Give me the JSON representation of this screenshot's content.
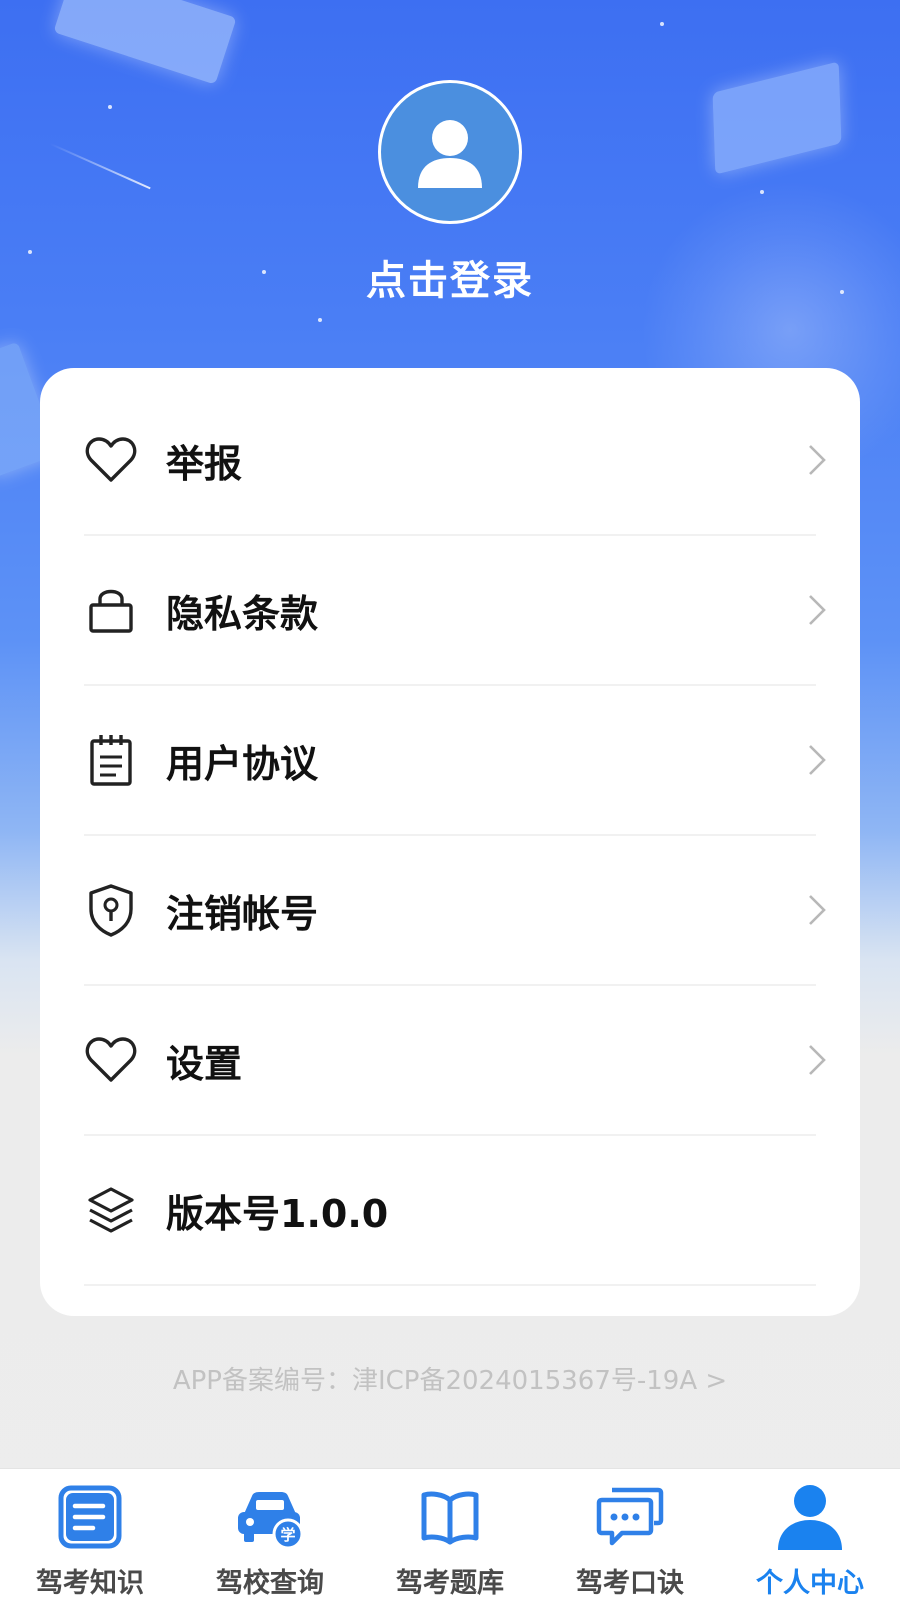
{
  "profile": {
    "login_prompt": "点击登录",
    "avatar_icon": "user-avatar-icon"
  },
  "menu": {
    "items": [
      {
        "label": "举报",
        "icon": "heart-icon",
        "has_chevron": true
      },
      {
        "label": "隐私条款",
        "icon": "lock-icon",
        "has_chevron": true
      },
      {
        "label": "用户协议",
        "icon": "notepad-icon",
        "has_chevron": true
      },
      {
        "label": "注销帐号",
        "icon": "shield-keyhole-icon",
        "has_chevron": true
      },
      {
        "label": "设置",
        "icon": "heart-icon",
        "has_chevron": true
      },
      {
        "label": "版本号1.0.0",
        "icon": "layers-icon",
        "has_chevron": false
      }
    ]
  },
  "footer": {
    "icp_record": "APP备案编号：津ICP备2024015367号-19A >"
  },
  "tabbar": {
    "tabs": [
      {
        "label": "驾考知识",
        "icon": "document-icon",
        "active": false
      },
      {
        "label": "驾校查询",
        "icon": "car-school-icon",
        "active": false
      },
      {
        "label": "驾考题库",
        "icon": "book-icon",
        "active": false
      },
      {
        "label": "驾考口诀",
        "icon": "chat-bubbles-icon",
        "active": false
      },
      {
        "label": "个人中心",
        "icon": "person-icon",
        "active": true
      }
    ]
  },
  "colors": {
    "primary_blue": "#3d6ff2",
    "tab_active": "#1a82ef",
    "tab_icon_blue": "#2f80e8",
    "avatar_bg": "#4b8fdf"
  }
}
